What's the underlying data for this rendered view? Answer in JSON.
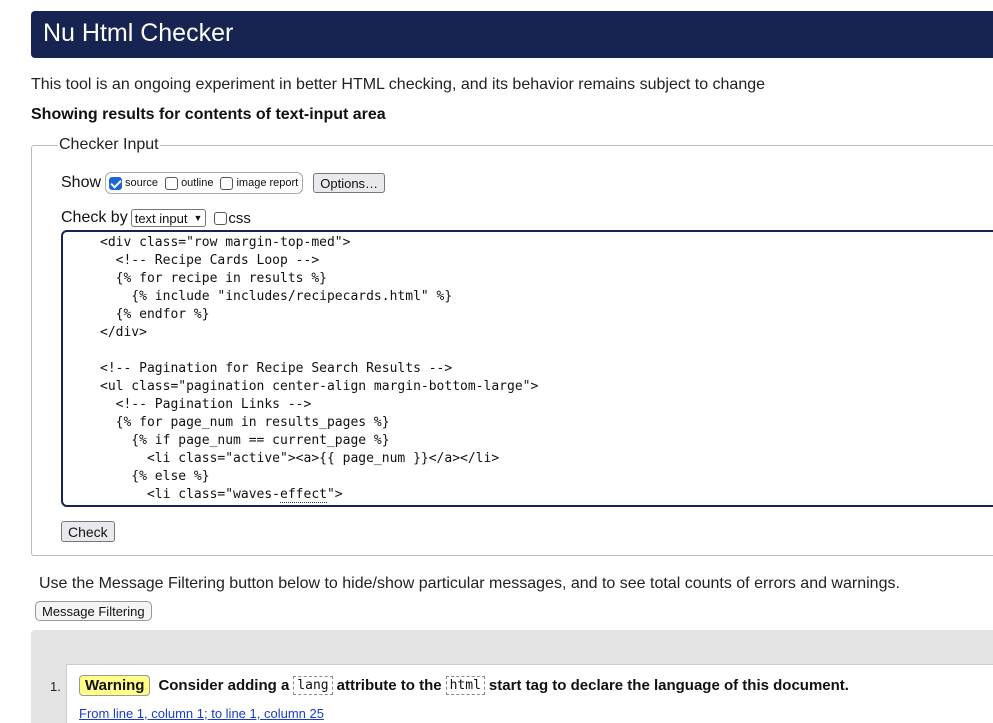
{
  "header": {
    "title": "Nu Html Checker"
  },
  "intro_text": "This tool is an ongoing experiment in better HTML checking, and its behavior remains subject to change",
  "showing_text": "Showing results for contents of text-input area",
  "checker": {
    "legend": "Checker Input",
    "show_label": "Show",
    "options": [
      {
        "label": "source",
        "checked": true
      },
      {
        "label": "outline",
        "checked": false
      },
      {
        "label": "image report",
        "checked": false
      }
    ],
    "options_button": "Options…",
    "check_by_label": "Check by",
    "check_by_value": "text input",
    "css_label": "css",
    "css_checked": false,
    "source_lines": [
      "<div class=\"row margin-top-med\">",
      "  <!-- Recipe Cards Loop -->",
      "  {% for recipe in results %}",
      "    {% include \"includes/recipecards.html\" %}",
      "  {% endfor %}",
      "</div>",
      "",
      "<!-- Pagination for Recipe Search Results -->",
      "<ul class=\"pagination center-align margin-bottom-large\">",
      "  <!-- Pagination Links -->",
      "  {% for page_num in results_pages %}",
      "    {% if page_num == current_page %}",
      "      <li class=\"active\"><a>{{ page_num }}</a></li>",
      "    {% else %}",
      "      <li class=\"waves-effect\">"
    ],
    "check_button": "Check"
  },
  "filter": {
    "text": "Use the Message Filtering button below to hide/show particular messages, and to see total counts of errors and warnings.",
    "button": "Message Filtering"
  },
  "messages": [
    {
      "number": "1.",
      "type": "Warning",
      "text_before": "Consider adding a",
      "code1": "lang",
      "text_middle": "attribute to the",
      "code2": "html",
      "text_after": "start tag to declare the language of this document.",
      "location": "From line 1, column 1; to line 1, column 25"
    }
  ],
  "colors": {
    "header_bg": "#172350",
    "warning_badge": "#ffff88",
    "link": "#1a3ccc",
    "checkbox_checked": "#1a66d8"
  }
}
